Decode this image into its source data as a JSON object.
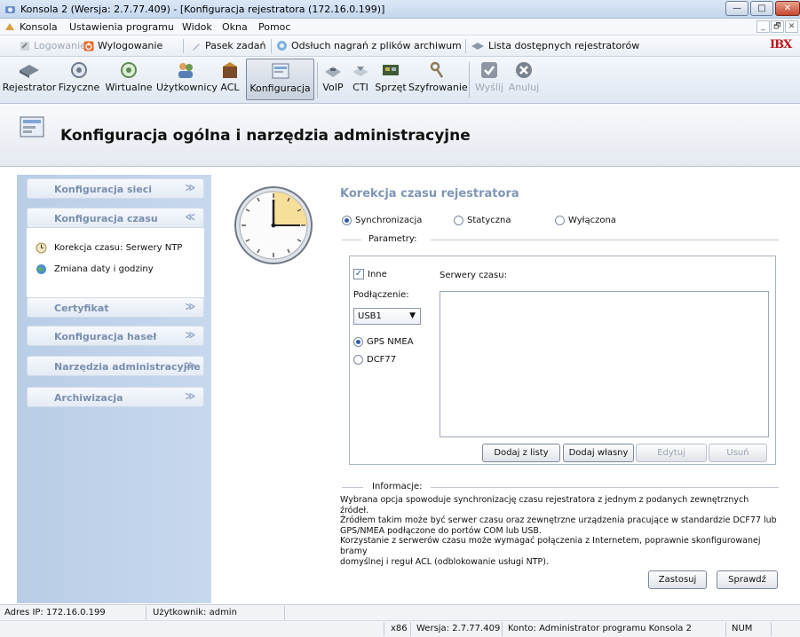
{
  "window": {
    "title": "Konsola 2 (Wersja: 2.7.77.409) - [Konfiguracja rejestratora (172.16.0.199)]",
    "minimize": "—",
    "maximize": "□",
    "close": "✕"
  },
  "menu": {
    "items": [
      "Konsola",
      "Ustawienia programu",
      "Widok",
      "Okna",
      "Pomoc"
    ],
    "mdi_minimize": "_",
    "mdi_restore": "🗗",
    "mdi_close": "✕"
  },
  "quickbar": {
    "login": "Logowanie",
    "logout": "Wylogowanie",
    "taskbar": "Pasek zadań",
    "playback": "Odsłuch nagrań z plików archiwum",
    "recorders": "Lista dostępnych rejestratorów",
    "brand": "IBX"
  },
  "toolbar": {
    "items": [
      "Rejestrator",
      "Fizyczne",
      "Wirtualne",
      "Użytkownicy",
      "ACL",
      "Konfiguracja",
      "VoIP",
      "CTI",
      "Sprzęt",
      "Szyfrowanie",
      "Wyślij",
      "Anuluj"
    ],
    "active": "Konfiguracja"
  },
  "header": {
    "title": "Konfiguracja ogólna i narzędzia administracyjne"
  },
  "sidebar": {
    "groups": [
      {
        "label": "Konfiguracja sieci",
        "chevron": "≫"
      },
      {
        "label": "Konfiguracja czasu",
        "chevron": "≪"
      },
      {
        "label": "Certyfikat",
        "chevron": "≫"
      },
      {
        "label": "Konfiguracja haseł",
        "chevron": "≫"
      },
      {
        "label": "Narzędzia administracyjne",
        "chevron": "≫"
      },
      {
        "label": "Archiwizacja",
        "chevron": "≫"
      }
    ],
    "items": [
      "Korekcja czasu: Serwery NTP",
      "Zmiana daty i godziny"
    ]
  },
  "content": {
    "title": "Korekcja czasu rejestratora",
    "modes": [
      "Synchronizacja",
      "Statyczna",
      "Wyłączona"
    ],
    "selected_mode": "Synchronizacja",
    "params_label": "Parametry:",
    "other_label": "Inne",
    "other_checked": true,
    "connection_label": "Podłączenie:",
    "connection_value": "USB1",
    "protocols": [
      "GPS NMEA",
      "DCF77"
    ],
    "selected_protocol": "GPS NMEA",
    "servers_label": "Serwery czasu:",
    "buttons": {
      "add_from_list": "Dodaj z listy",
      "add_own": "Dodaj własny",
      "edit": "Edytuj",
      "remove": "Usuń"
    },
    "info_label": "Informacje:",
    "info_lines": [
      "Wybrana opcja spowoduje synchronizację czasu rejestratora z jednym z podanych zewnętrznych źródeł.",
      "Źródłem takim może być serwer czasu oraz zewnętrzne urządzenia pracujące w standardzie DCF77 lub",
      "GPS/NMEA podłączone do portów COM lub USB.",
      "Korzystanie z serwerów czasu może wymagać połączenia z Internetem, poprawnie skonfigurowanej bramy",
      "domyślnej i reguł ACL (odblokowanie usługi NTP)."
    ],
    "apply": "Zastosuj",
    "check": "Sprawdź"
  },
  "status": {
    "ip": "Adres IP: 172.16.0.199",
    "user": "Użytkownik: admin",
    "arch": "x86",
    "version": "Wersja: 2.7.77.409",
    "account": "Konto: Administrator programu Konsola 2",
    "num": "NUM"
  }
}
